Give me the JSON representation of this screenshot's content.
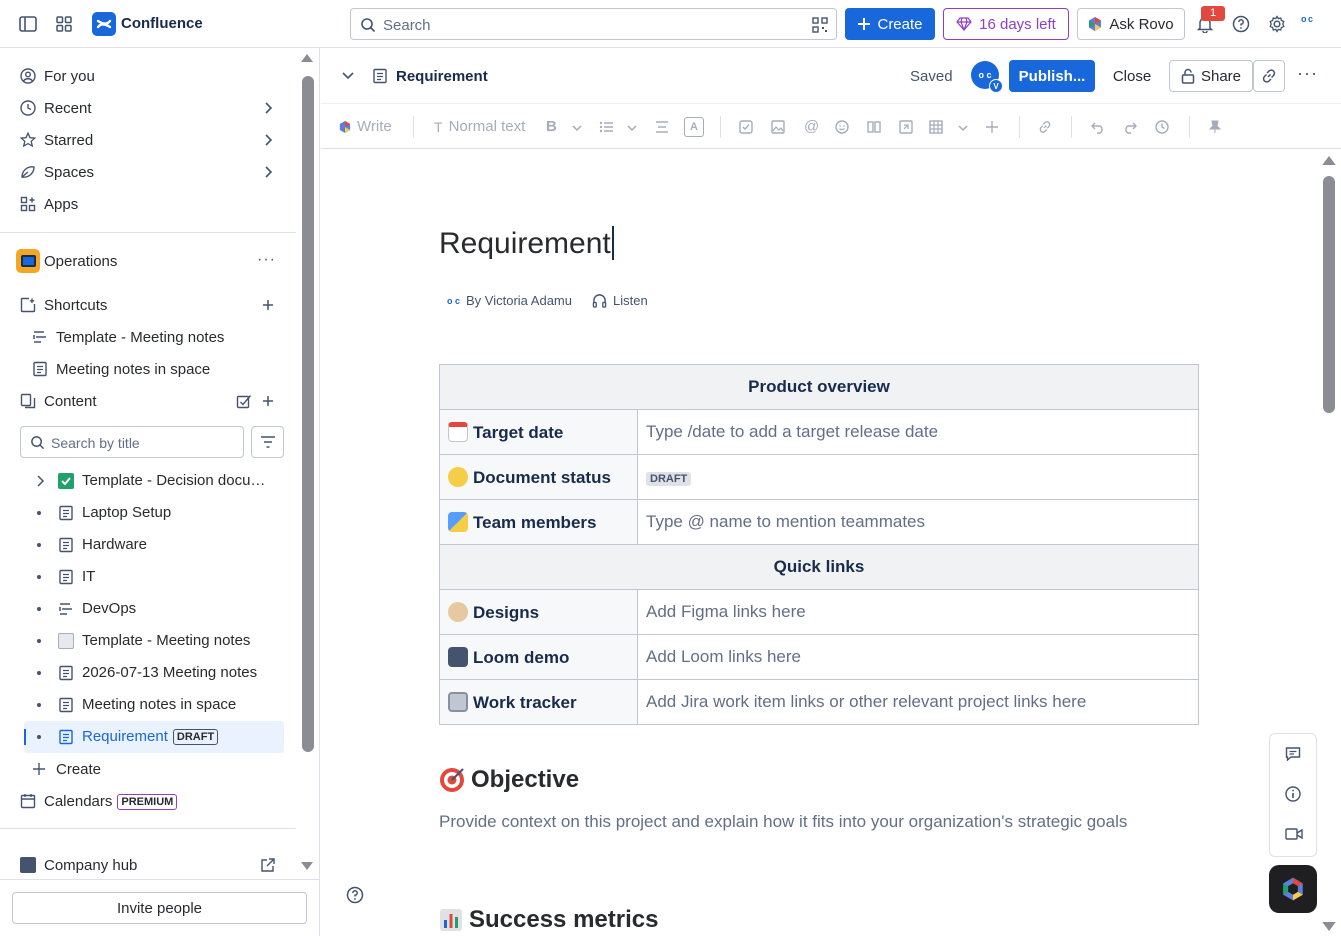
{
  "topbar": {
    "app_name": "Confluence",
    "search_placeholder": "Search",
    "create_label": "Create",
    "trial_label": "16 days left",
    "rovo_label": "Ask Rovo",
    "notification_count": "1",
    "avatar_initials": "o c"
  },
  "sidebar": {
    "nav": [
      {
        "label": "For you",
        "icon": "user-circle-icon"
      },
      {
        "label": "Recent",
        "icon": "clock-icon"
      },
      {
        "label": "Starred",
        "icon": "star-icon"
      },
      {
        "label": "Spaces",
        "icon": "spaces-icon"
      },
      {
        "label": "Apps",
        "icon": "apps-icon"
      }
    ],
    "space_name": "Operations",
    "shortcuts_label": "Shortcuts",
    "shortcuts": [
      "Template - Meeting notes",
      "Meeting notes in space"
    ],
    "content_label": "Content",
    "filter_placeholder": "Search by title",
    "tree": [
      {
        "label": "Template - Decision documentation"
      },
      {
        "label": "Laptop Setup"
      },
      {
        "label": "Hardware"
      },
      {
        "label": "IT"
      },
      {
        "label": "DevOps"
      },
      {
        "label": "Template - Meeting notes"
      },
      {
        "label": "2026-07-13 Meeting notes"
      },
      {
        "label": "Meeting notes in space"
      },
      {
        "label": "Requirement",
        "badge": "DRAFT"
      }
    ],
    "create_label": "Create",
    "calendars_label": "Calendars",
    "calendars_badge": "PREMIUM",
    "company_hub_label": "Company hub",
    "invite_label": "Invite people"
  },
  "editor": {
    "breadcrumb_title": "Requirement",
    "saved_label": "Saved",
    "avatar_initials": "o c",
    "avatar_sub": "V",
    "publish_label": "Publish...",
    "close_label": "Close",
    "share_label": "Share",
    "toolbar": {
      "write_label": "Write",
      "text_style": "Normal text"
    }
  },
  "page": {
    "title": "Requirement",
    "byline": "By Victoria Adamu",
    "listen_label": "Listen",
    "table": {
      "header1": "Product overview",
      "rows1": [
        {
          "key": "Target date",
          "value": "Type /date to add a target release date",
          "emoji": "calendar"
        },
        {
          "key": "Document status",
          "value": "DRAFT",
          "emoji": "yellow-circle"
        },
        {
          "key": "Team members",
          "value": "Type @ name to mention teammates",
          "emoji": "runner"
        }
      ],
      "header2": "Quick links",
      "rows2": [
        {
          "key": "Designs",
          "value": "Add Figma links here",
          "emoji": "palette"
        },
        {
          "key": "Loom demo",
          "value": "Add Loom links here",
          "emoji": "camera"
        },
        {
          "key": "Work tracker",
          "value": "Add Jira work item links or other relevant project links here",
          "emoji": "card-box"
        }
      ]
    },
    "objective_heading": "Objective",
    "objective_text": "Provide context on this project and explain how it fits into your organization's strategic goals",
    "metrics_heading": "Success metrics"
  }
}
